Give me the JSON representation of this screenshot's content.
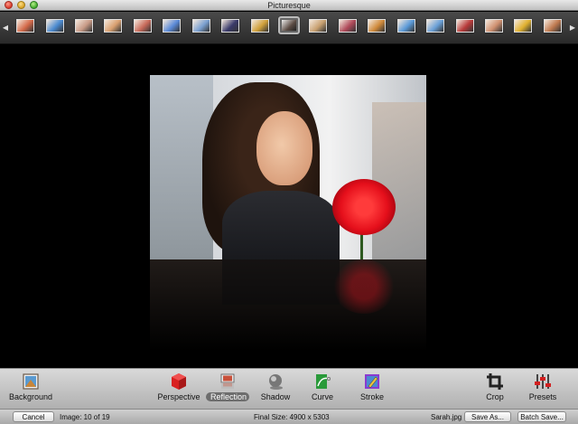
{
  "window": {
    "title": "Picturesque"
  },
  "thumbnails": {
    "selected_index": 10,
    "items": [
      {
        "color": "#d46a4a"
      },
      {
        "color": "#4a8ad0"
      },
      {
        "color": "#c89a86"
      },
      {
        "color": "#d9a070"
      },
      {
        "color": "#c86a5a"
      },
      {
        "color": "#5a8ad8"
      },
      {
        "color": "#7aa0d0"
      },
      {
        "color": "#3a3a6a"
      },
      {
        "color": "#d0a03a"
      },
      {
        "color": "#5a4a42"
      },
      {
        "color": "#c8a070"
      },
      {
        "color": "#b04a5a"
      },
      {
        "color": "#d08a3a"
      },
      {
        "color": "#5a9ad8"
      },
      {
        "color": "#6aa0d8"
      },
      {
        "color": "#b83a3a"
      },
      {
        "color": "#d09070"
      },
      {
        "color": "#e0b030"
      },
      {
        "color": "#c07a50"
      }
    ]
  },
  "toolbar": {
    "background": "Background",
    "perspective": "Perspective",
    "reflection": "Reflection",
    "shadow": "Shadow",
    "curve": "Curve",
    "stroke": "Stroke",
    "crop": "Crop",
    "presets": "Presets",
    "active_tool": "reflection"
  },
  "statusbar": {
    "cancel": "Cancel",
    "image_info": "Image: 10 of 19",
    "final_size": "Final Size:  4900 x 5303",
    "filename": "Sarah.jpg",
    "save_as": "Save As...",
    "batch_save": "Batch Save..."
  },
  "colors": {
    "reflection_active": "#6d6d6d",
    "perspective_icon": "#d92020",
    "curve_icon": "#2a9a3a",
    "stroke_icon": "#8a3ad0"
  }
}
